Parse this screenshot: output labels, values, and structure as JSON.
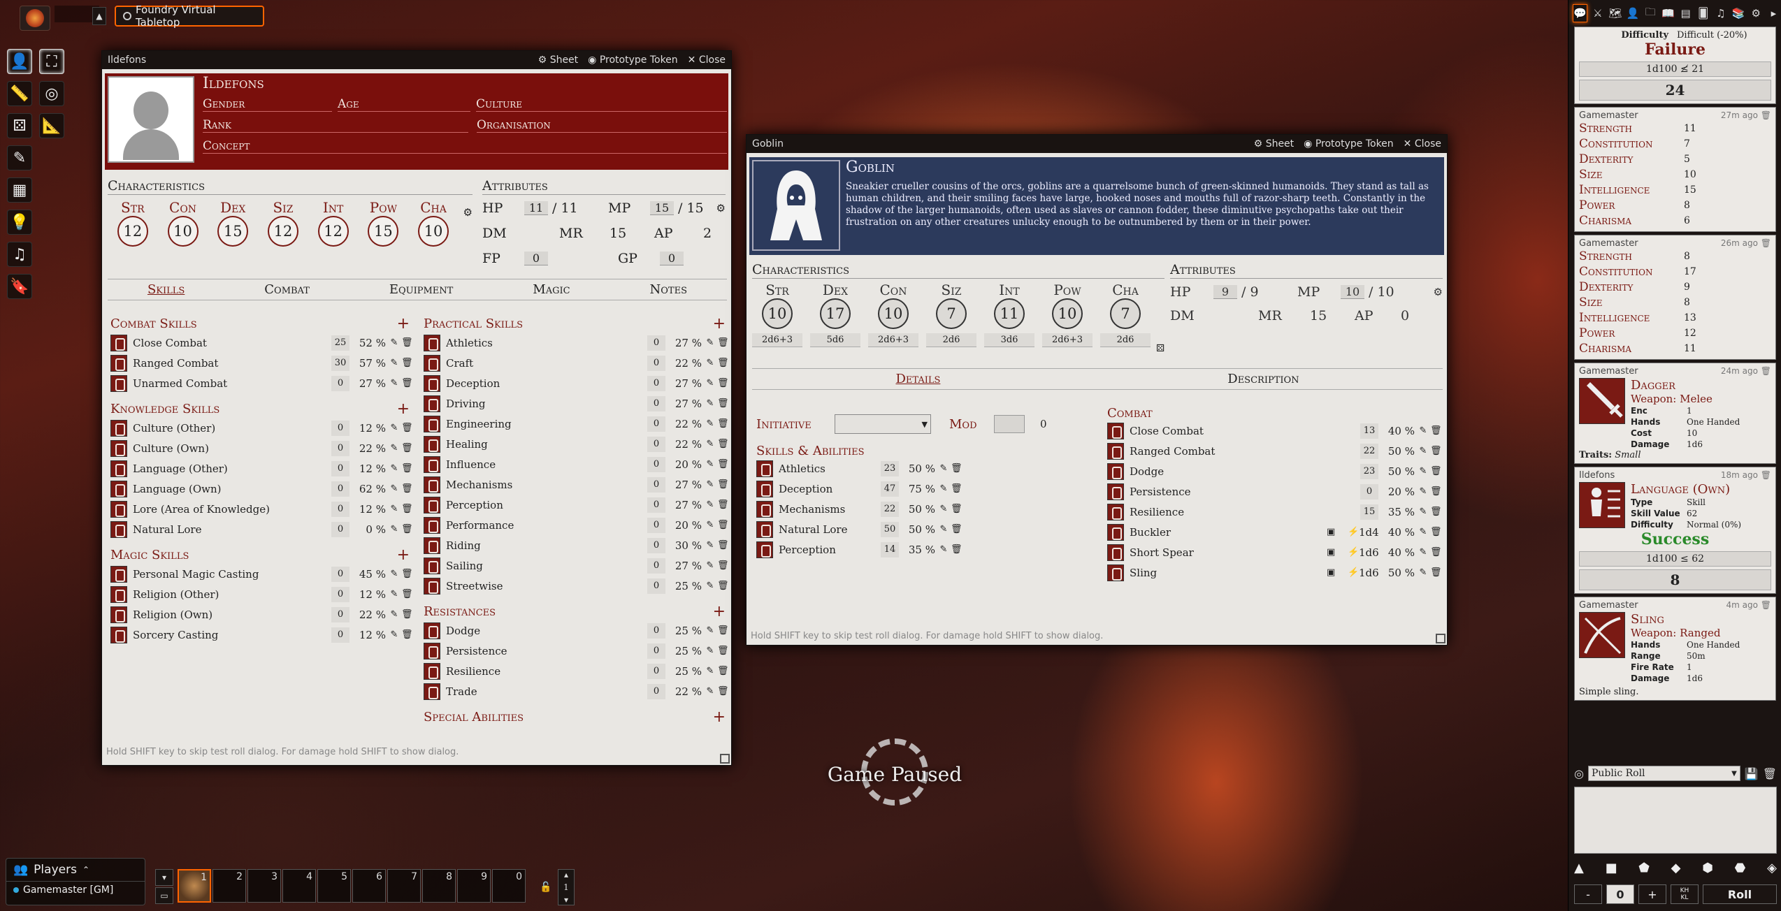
{
  "nav": {
    "scene_tab": "Foundry Virtual Tabletop",
    "collapse": "▲"
  },
  "controls": [
    "user-icon",
    "fullscreen-icon",
    "ruler-icon",
    "target-icon",
    "dice-group-icon",
    "measure-icon",
    "pencil-icon",
    "wall-icon",
    "lightbulb-icon",
    "music-icon",
    "bookmark-icon"
  ],
  "ildefons": {
    "window_title": "Ildefons",
    "sheet": "Sheet",
    "prototype": "Prototype Token",
    "close": "Close",
    "name": "Ildefons",
    "labels": {
      "gender": "Gender",
      "age": "Age",
      "culture": "Culture",
      "rank": "Rank",
      "organisation": "Organisation",
      "concept": "Concept"
    },
    "char_heading": "Characteristics",
    "attr_heading": "Attributes",
    "chars": [
      {
        "l": "Str",
        "v": "12"
      },
      {
        "l": "Con",
        "v": "10"
      },
      {
        "l": "Dex",
        "v": "15"
      },
      {
        "l": "Siz",
        "v": "12"
      },
      {
        "l": "Int",
        "v": "12"
      },
      {
        "l": "Pow",
        "v": "15"
      },
      {
        "l": "Cha",
        "v": "10"
      }
    ],
    "attrs": {
      "hp_l": "HP",
      "hp": "11",
      "hp_max": "/ 11",
      "mp_l": "MP",
      "mp": "15",
      "mp_max": "/ 15",
      "dm_l": "DM",
      "mr_l": "MR",
      "mr": "15",
      "ap_l": "AP",
      "ap": "2",
      "fp_l": "FP",
      "fp": "0",
      "gp_l": "GP",
      "gp": "0"
    },
    "tabs": [
      "Skills",
      "Combat",
      "Equipment",
      "Magic",
      "Notes"
    ],
    "groups": [
      {
        "title": "Combat Skills",
        "rows": [
          [
            "Close Combat",
            "25",
            "52 %"
          ],
          [
            "Ranged Combat",
            "30",
            "57 %"
          ],
          [
            "Unarmed Combat",
            "0",
            "27 %"
          ]
        ]
      },
      {
        "title": "Knowledge Skills",
        "rows": [
          [
            "Culture (Other)",
            "0",
            "12 %"
          ],
          [
            "Culture (Own)",
            "0",
            "22 %"
          ],
          [
            "Language (Other)",
            "0",
            "12 %"
          ],
          [
            "Language (Own)",
            "0",
            "62 %"
          ],
          [
            "Lore (Area of Knowledge)",
            "0",
            "12 %"
          ],
          [
            "Natural Lore",
            "0",
            "0 %"
          ]
        ]
      },
      {
        "title": "Magic Skills",
        "rows": [
          [
            "Personal Magic Casting",
            "0",
            "45 %"
          ],
          [
            "Religion (Other)",
            "0",
            "12 %"
          ],
          [
            "Religion (Own)",
            "0",
            "22 %"
          ],
          [
            "Sorcery Casting",
            "0",
            "12 %"
          ]
        ]
      }
    ],
    "groups_right": [
      {
        "title": "Practical Skills",
        "rows": [
          [
            "Athletics",
            "0",
            "27 %"
          ],
          [
            "Craft",
            "0",
            "22 %"
          ],
          [
            "Deception",
            "0",
            "27 %"
          ],
          [
            "Driving",
            "0",
            "27 %"
          ],
          [
            "Engineering",
            "0",
            "22 %"
          ],
          [
            "Healing",
            "0",
            "22 %"
          ],
          [
            "Influence",
            "0",
            "20 %"
          ],
          [
            "Mechanisms",
            "0",
            "27 %"
          ],
          [
            "Perception",
            "0",
            "27 %"
          ],
          [
            "Performance",
            "0",
            "20 %"
          ],
          [
            "Riding",
            "0",
            "30 %"
          ],
          [
            "Sailing",
            "0",
            "27 %"
          ],
          [
            "Streetwise",
            "0",
            "25 %"
          ]
        ]
      },
      {
        "title": "Resistances",
        "rows": [
          [
            "Dodge",
            "0",
            "25 %"
          ],
          [
            "Persistence",
            "0",
            "25 %"
          ],
          [
            "Resilience",
            "0",
            "25 %"
          ],
          [
            "Trade",
            "0",
            "22 %"
          ]
        ]
      },
      {
        "title": "Special Abilities",
        "rows": []
      }
    ],
    "footer": "Hold SHIFT key to skip test roll dialog. For damage hold SHIFT to show dialog."
  },
  "goblin": {
    "window_title": "Goblin",
    "sheet": "Sheet",
    "prototype": "Prototype Token",
    "close": "Close",
    "name": "Goblin",
    "desc": "Sneakier crueller cousins of the orcs, goblins are a quarrelsome bunch of green-skinned humanoids. They stand as tall as human children, and their smiling faces have large, hooked noses and mouths full of razor-sharp teeth. Constantly in the shadow of the larger humanoids, often used as slaves or cannon fodder, these diminutive psychopaths take out their frustration on any other creatures unlucky enough to be outnumbered by them or in their power.",
    "char_heading": "Characteristics",
    "attr_heading": "Attributes",
    "chars": [
      {
        "l": "Str",
        "v": "10",
        "d": "2d6+3"
      },
      {
        "l": "Dex",
        "v": "17",
        "d": "5d6"
      },
      {
        "l": "Con",
        "v": "10",
        "d": "2d6+3"
      },
      {
        "l": "Siz",
        "v": "7",
        "d": "2d6"
      },
      {
        "l": "Int",
        "v": "11",
        "d": "3d6"
      },
      {
        "l": "Pow",
        "v": "10",
        "d": "2d6+3"
      },
      {
        "l": "Cha",
        "v": "7",
        "d": "2d6"
      }
    ],
    "attrs": {
      "hp_l": "HP",
      "hp": "9",
      "hp_max": "/ 9",
      "mp_l": "MP",
      "mp": "10",
      "mp_max": "/ 10",
      "dm_l": "DM",
      "mr_l": "MR",
      "mr": "15",
      "ap_l": "AP",
      "ap": "0"
    },
    "tabs": [
      "Details",
      "Description"
    ],
    "initiative": "Initiative",
    "mod": "Mod",
    "mod_val": "0",
    "skills_title": "Skills & Abilities",
    "skills": [
      [
        "Athletics",
        "23",
        "50 %"
      ],
      [
        "Deception",
        "47",
        "75 %"
      ],
      [
        "Mechanisms",
        "22",
        "50 %"
      ],
      [
        "Natural Lore",
        "50",
        "50 %"
      ],
      [
        "Perception",
        "14",
        "35 %"
      ]
    ],
    "combat_title": "Combat",
    "combat": [
      [
        "Close Combat",
        "13",
        "40 %"
      ],
      [
        "Ranged Combat",
        "22",
        "50 %"
      ],
      [
        "Dodge",
        "23",
        "50 %"
      ],
      [
        "Persistence",
        "0",
        "20 %"
      ],
      [
        "Resilience",
        "15",
        "35 %"
      ]
    ],
    "weapons": [
      [
        "Buckler",
        "1d4",
        "40 %"
      ],
      [
        "Short Spear",
        "1d6",
        "40 %"
      ],
      [
        "Sling",
        "1d6",
        "50 %"
      ]
    ],
    "footer": "Hold SHIFT key to skip test roll dialog. For damage hold SHIFT to show dialog."
  },
  "chat": {
    "m0": {
      "diff_l": "Difficulty",
      "diff": "Difficult (-20%)",
      "result": "Failure",
      "formula": "1d100 ≰ 21",
      "total": "24"
    },
    "m1": {
      "speaker": "Gamemaster",
      "time": "27m ago",
      "rows": [
        [
          "Strength",
          "11"
        ],
        [
          "Constitution",
          "7"
        ],
        [
          "Dexterity",
          "5"
        ],
        [
          "Size",
          "10"
        ],
        [
          "Intelligence",
          "15"
        ],
        [
          "Power",
          "8"
        ],
        [
          "Charisma",
          "6"
        ]
      ]
    },
    "m2": {
      "speaker": "Gamemaster",
      "time": "26m ago",
      "rows": [
        [
          "Strength",
          "8"
        ],
        [
          "Constitution",
          "17"
        ],
        [
          "Dexterity",
          "9"
        ],
        [
          "Size",
          "8"
        ],
        [
          "Intelligence",
          "13"
        ],
        [
          "Power",
          "12"
        ],
        [
          "Charisma",
          "11"
        ]
      ]
    },
    "m3": {
      "speaker": "Gamemaster",
      "time": "24m ago",
      "title": "Dagger",
      "sub": "Weapon: Melee",
      "props": [
        [
          "Enc",
          "1"
        ],
        [
          "Hands",
          "One Handed"
        ],
        [
          "Cost",
          "10"
        ],
        [
          "Damage",
          "1d6"
        ]
      ],
      "traits_l": "Traits:",
      "traits": "Small"
    },
    "m4": {
      "speaker": "Ildefons",
      "time": "18m ago",
      "title": "Language (Own)",
      "props": [
        [
          "Type",
          "Skill"
        ],
        [
          "Skill Value",
          "62"
        ],
        [
          "Difficulty",
          "Normal (0%)"
        ]
      ],
      "result": "Success",
      "formula": "1d100 ≤ 62",
      "total": "8"
    },
    "m5": {
      "speaker": "Gamemaster",
      "time": "4m ago",
      "title": "Sling",
      "sub": "Weapon: Ranged",
      "props": [
        [
          "Hands",
          "One Handed"
        ],
        [
          "Range",
          "50m"
        ],
        [
          "Fire Rate",
          "1"
        ],
        [
          "Damage",
          "1d6"
        ]
      ],
      "note": "Simple sling."
    },
    "roll_mode": "Public Roll",
    "dice_bar": {
      "minus": "-",
      "zero": "0",
      "plus": "+",
      "roll": "Roll",
      "kh": "KH",
      "kl": "KL"
    }
  },
  "players": {
    "title": "Players",
    "gm": "Gamemaster [GM]"
  },
  "hotbar": {
    "page": "1",
    "slots": [
      "1",
      "2",
      "3",
      "4",
      "5",
      "6",
      "7",
      "8",
      "9",
      "0"
    ]
  },
  "paused": "Game Paused"
}
